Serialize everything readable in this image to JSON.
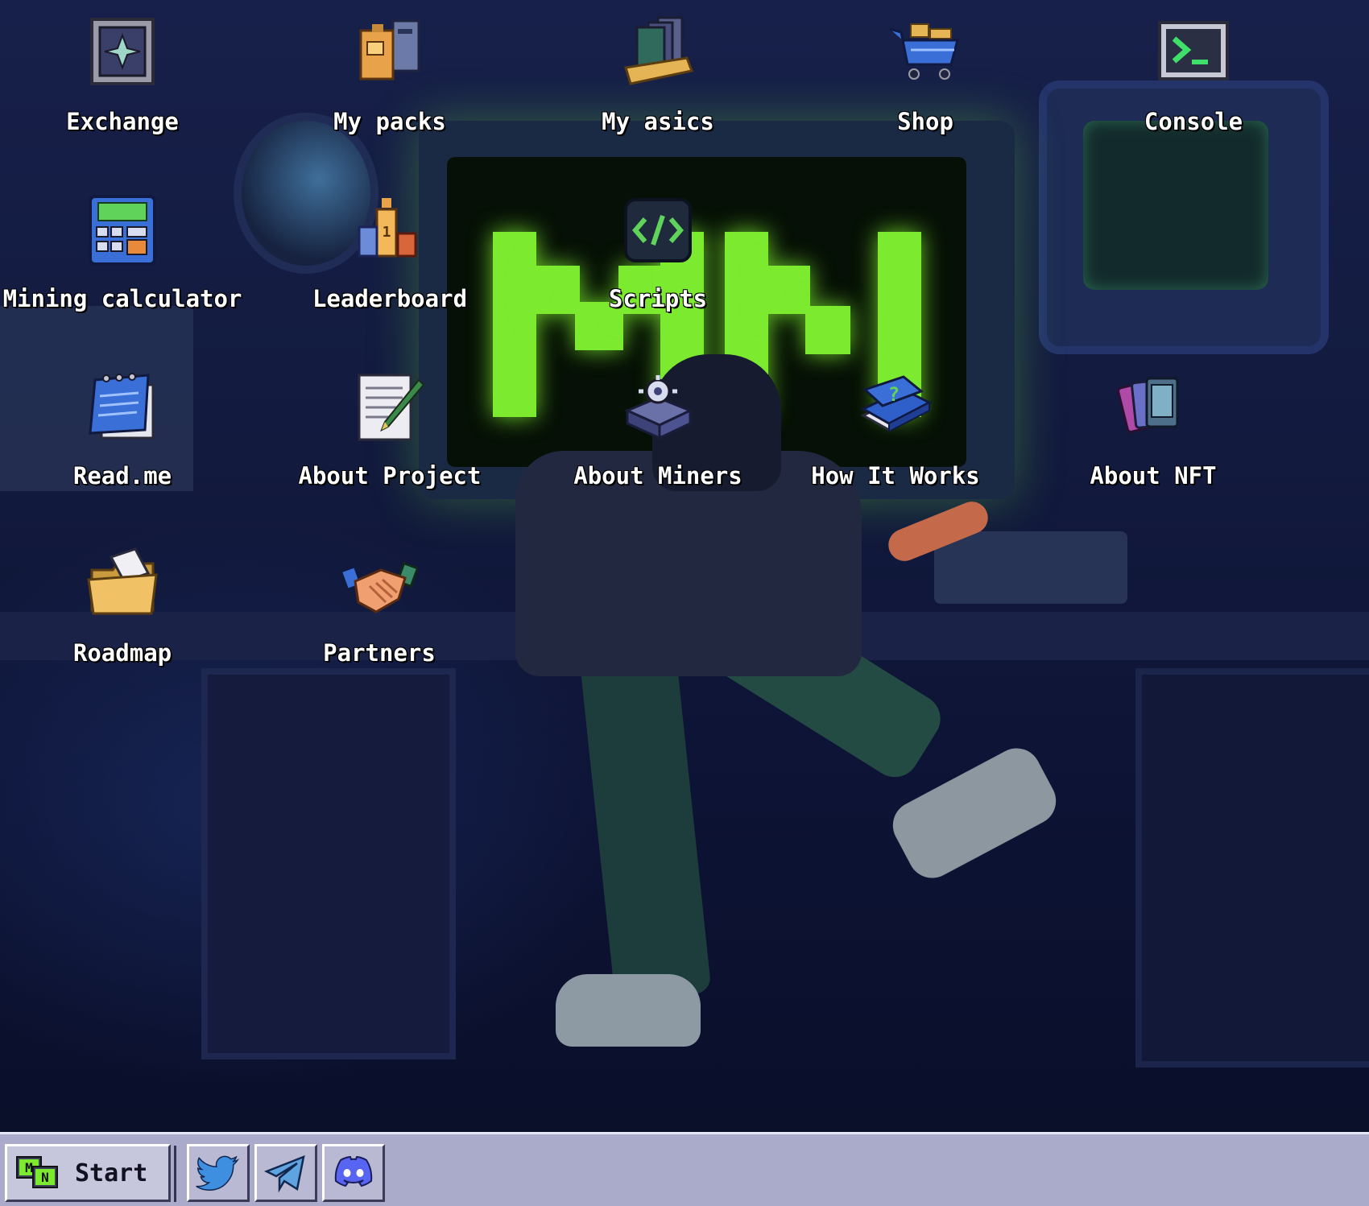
{
  "desktop": {
    "icons": [
      {
        "label": "Exchange",
        "icon": "exchange-icon"
      },
      {
        "label": "My packs",
        "icon": "packs-icon"
      },
      {
        "label": "My asics",
        "icon": "asics-icon"
      },
      {
        "label": "Shop",
        "icon": "shopping-cart-icon"
      },
      {
        "label": "Console",
        "icon": "terminal-icon"
      },
      {
        "label": "Mining calculator",
        "icon": "calculator-icon"
      },
      {
        "label": "Leaderboard",
        "icon": "podium-icon"
      },
      {
        "label": "Scripts",
        "icon": "code-icon"
      },
      {
        "label": "Read.me",
        "icon": "notepad-icon"
      },
      {
        "label": "About Project",
        "icon": "document-pen-icon"
      },
      {
        "label": "About Miners",
        "icon": "miner-chip-icon"
      },
      {
        "label": "How It Works",
        "icon": "help-book-icon"
      },
      {
        "label": "About NFT",
        "icon": "nft-cards-icon"
      },
      {
        "label": "Roadmap",
        "icon": "folder-icon"
      },
      {
        "label": "Partners",
        "icon": "handshake-icon"
      }
    ]
  },
  "taskbar": {
    "start_label": "Start",
    "start_icon": "mn-logo-icon",
    "social": [
      {
        "name": "twitter",
        "icon": "twitter-icon"
      },
      {
        "name": "telegram",
        "icon": "telegram-icon"
      },
      {
        "name": "discord",
        "icon": "discord-icon"
      }
    ]
  },
  "colors": {
    "accent_green": "#7cea2f",
    "taskbar": "#aaaacb",
    "wallpaper_dark": "#0c1030"
  }
}
